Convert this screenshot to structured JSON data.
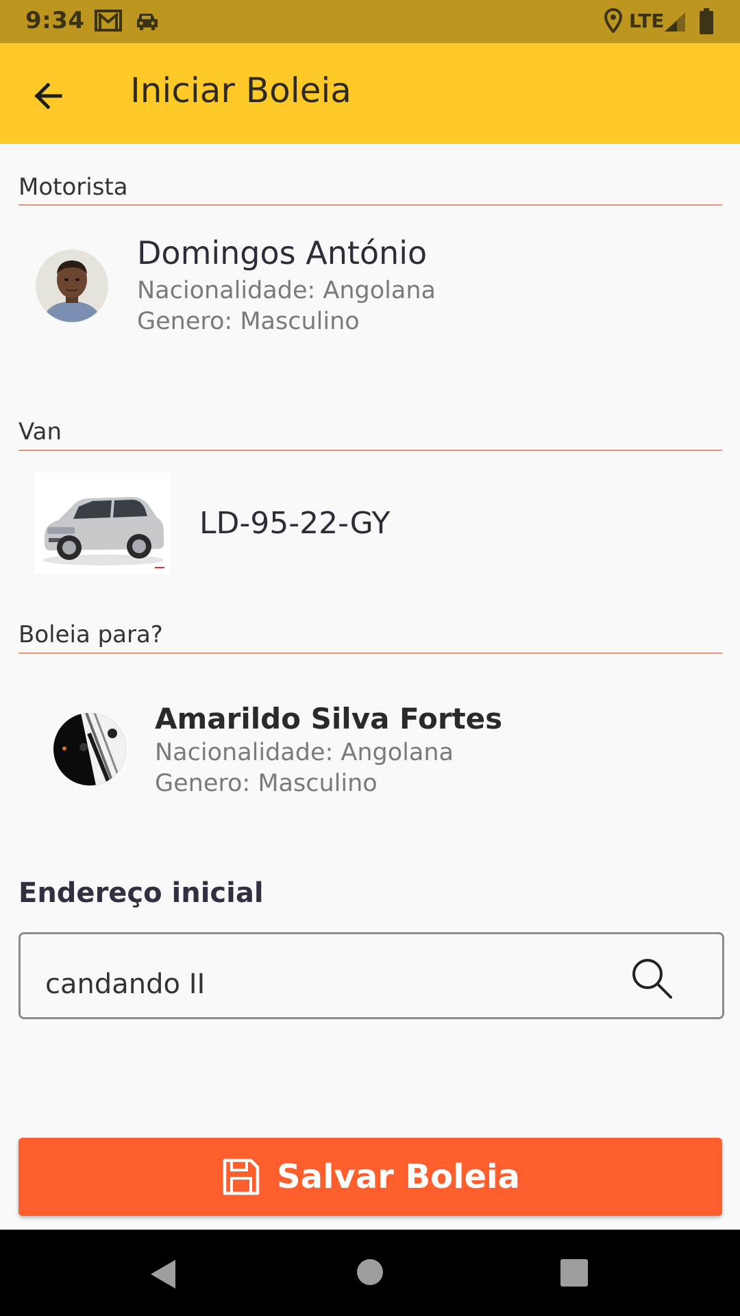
{
  "status_bar": {
    "time": "9:34",
    "network": "LTE",
    "icons": [
      "gmail-icon",
      "car-icon",
      "location-icon",
      "signal-icon",
      "battery-icon"
    ]
  },
  "app_bar": {
    "title": "Iniciar Boleia",
    "back_icon": "arrow-back-icon",
    "background": "#ffc928"
  },
  "driver_section": {
    "label": "Motorista",
    "name": "Domingos António",
    "nationality": "Nacionalidade: Angolana",
    "gender": "Genero: Masculino"
  },
  "van_section": {
    "label": "Van",
    "plate": "LD-95-22-GY"
  },
  "passenger_section": {
    "label": "Boleia para?",
    "name": "Amarildo Silva Fortes",
    "nationality": "Nacionalidade: Angolana",
    "gender": "Genero: Masculino"
  },
  "address": {
    "label": "Endereço inicial",
    "value": "candando II",
    "search_icon": "search-icon"
  },
  "save_button": {
    "label": "Salvar Boleia",
    "icon": "save-icon",
    "color": "#ff5f2d"
  },
  "colors": {
    "accent_line": "#f0937a",
    "status_bar": "#bd961f"
  }
}
